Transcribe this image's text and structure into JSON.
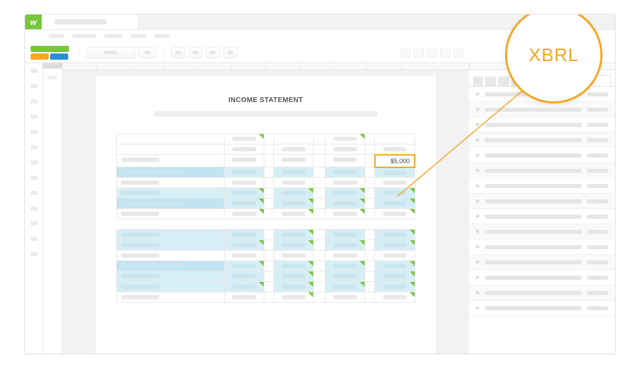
{
  "app": {
    "logo_letter": "w"
  },
  "document": {
    "title": "INCOME STATEMENT",
    "highlighted_value": "$5,000",
    "table": {
      "columns": 4,
      "rows": [
        {
          "type": "header"
        },
        {
          "type": "subheader"
        },
        {
          "type": "value-highlight"
        },
        {
          "type": "band-lead"
        },
        {
          "type": "plain"
        },
        {
          "type": "band",
          "tagged": true
        },
        {
          "type": "band-lead",
          "tagged": true
        },
        {
          "type": "plain",
          "tagged": true
        },
        {
          "type": "spacer"
        },
        {
          "type": "band",
          "tagged_trail": true
        },
        {
          "type": "band",
          "tagged": true
        },
        {
          "type": "plain"
        },
        {
          "type": "band-lead",
          "tagged": true
        },
        {
          "type": "band",
          "tagged_trail": true
        },
        {
          "type": "band",
          "tagged": true
        },
        {
          "type": "plain",
          "tagged_trail": true
        }
      ]
    }
  },
  "callout": {
    "label": "XBRL"
  },
  "right_panel": {
    "row_count": 15
  }
}
